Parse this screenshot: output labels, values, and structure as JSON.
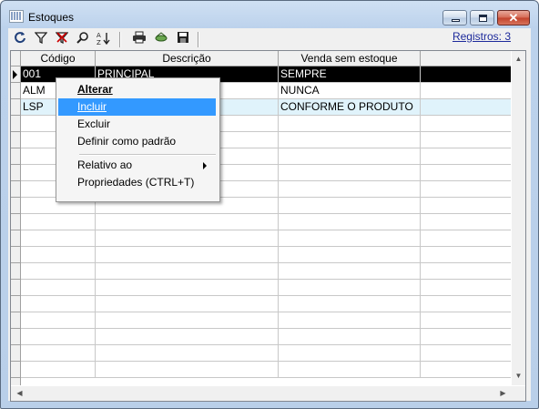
{
  "window": {
    "title": "Estoques",
    "close_glyph": "✕"
  },
  "toolbar": {
    "icons": [
      "refresh-icon",
      "filter-icon",
      "clear-filter-icon",
      "find-icon",
      "sort-icon",
      "print-icon",
      "export-icon",
      "save-icon"
    ],
    "registros": "Registros: 3"
  },
  "grid": {
    "columns": [
      "Código",
      "Descrição",
      "Venda sem estoque"
    ],
    "rows": [
      {
        "codigo": "001",
        "descricao": "PRINCIPAL",
        "venda": "SEMPRE"
      },
      {
        "codigo": "ALM",
        "descricao": "",
        "venda": "NUNCA"
      },
      {
        "codigo": "LSP",
        "descricao": "",
        "venda": "CONFORME O PRODUTO"
      }
    ]
  },
  "context_menu": {
    "alterar": "Alterar",
    "incluir": "Incluir",
    "excluir": "Excluir",
    "definir_padrao": "Definir como padrão",
    "relativo_ao": "Relativo ao",
    "propriedades": "Propriedades (CTRL+T)"
  },
  "colors": {
    "selection": "#000000",
    "highlight": "#3399ff",
    "alt_row": "#e0f3fb",
    "link": "#1d2a9b"
  }
}
